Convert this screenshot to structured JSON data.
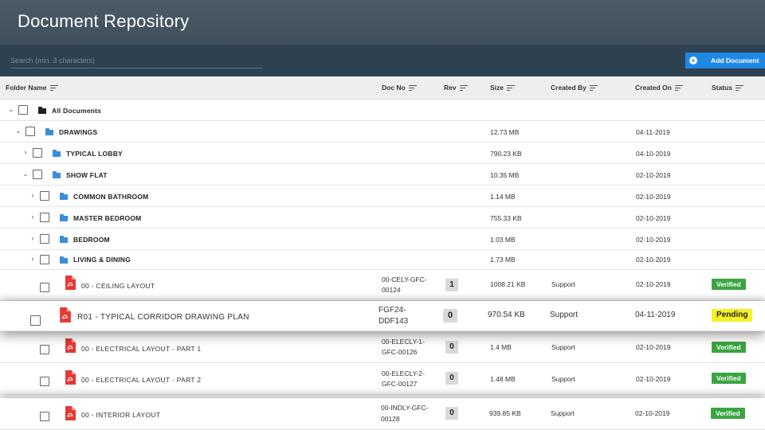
{
  "app": {
    "title": "Document Repository"
  },
  "search": {
    "placeholder": "Search (min. 3 characters)"
  },
  "toolbar": {
    "add_label": "Add Document",
    "plus": "+"
  },
  "columns": {
    "folder_name": "Folder Name",
    "doc_no": "Doc No",
    "rev": "Rev",
    "size": "Size",
    "created_by": "Created By",
    "created_on": "Created On",
    "status": "Status"
  },
  "colors": {
    "header": "#45565f",
    "toolbar": "#2e4150",
    "accent": "#1e88e5",
    "verified": "#3aa540",
    "pending": "#f5f226",
    "folder": "#3b8ed8",
    "folder_root": "#222222",
    "pdf": "#e53935"
  },
  "tree": [
    {
      "name": "All Documents",
      "size": "",
      "created_on": "",
      "expanded": true
    },
    {
      "name": "DRAWINGS",
      "size": "12.73 MB",
      "created_on": "04-11-2019",
      "expanded": true
    },
    {
      "name": "TYPICAL LOBBY",
      "size": "790.23 KB",
      "created_on": "04-10-2019",
      "expanded": false
    },
    {
      "name": "SHOW FLAT",
      "size": "10.35 MB",
      "created_on": "02-10-2019",
      "expanded": true
    },
    {
      "name": "COMMON BATHROOM",
      "size": "1.14 MB",
      "created_on": "02-10-2019",
      "expanded": false
    },
    {
      "name": "MASTER BEDROOM",
      "size": "755.33 KB",
      "created_on": "02-10-2019",
      "expanded": false
    },
    {
      "name": "BEDROOM",
      "size": "1.03 MB",
      "created_on": "02-10-2019",
      "expanded": false
    },
    {
      "name": "LIVING & DINING",
      "size": "1.73 MB",
      "created_on": "02-10-2019",
      "expanded": false
    }
  ],
  "documents": [
    {
      "name": "00 - CEILING LAYOUT",
      "doc_no_1": "00-CELY-GFC-",
      "doc_no_2": "00124",
      "rev": "1",
      "size": "1008.21 KB",
      "created_by": "Support",
      "created_on": "02-10-2019",
      "status": "Verified"
    },
    {
      "name": "R01 - TYPICAL CORRIDOR DRAWING PLAN",
      "doc_no_1": "FGF24-",
      "doc_no_2": "DDF143",
      "rev": "0",
      "size": "970.54 KB",
      "created_by": "Support",
      "created_on": "04-11-2019",
      "status": "Pending"
    },
    {
      "name": "00 - ELECTRICAL LAYOUT - PART 1",
      "doc_no_1": "00-ELECLY-1-",
      "doc_no_2": "GFC-00126",
      "rev": "0",
      "size": "1.4 MB",
      "created_by": "Support",
      "created_on": "02-10-2019",
      "status": "Verified"
    },
    {
      "name": "00 - ELECTRICAL LAYOUT - PART 2",
      "doc_no_1": "00-ELECLY-2-",
      "doc_no_2": "GFC-00127",
      "rev": "0",
      "size": "1.48 MB",
      "created_by": "Support",
      "created_on": "02-10-2019",
      "status": "Verified"
    },
    {
      "name": "00 - INTERIOR LAYOUT",
      "doc_no_1": "00-INDLY-GFC-",
      "doc_no_2": "00128",
      "rev": "0",
      "size": "939.85 KB",
      "created_by": "Support",
      "created_on": "02-10-2019",
      "status": "Verified"
    }
  ]
}
